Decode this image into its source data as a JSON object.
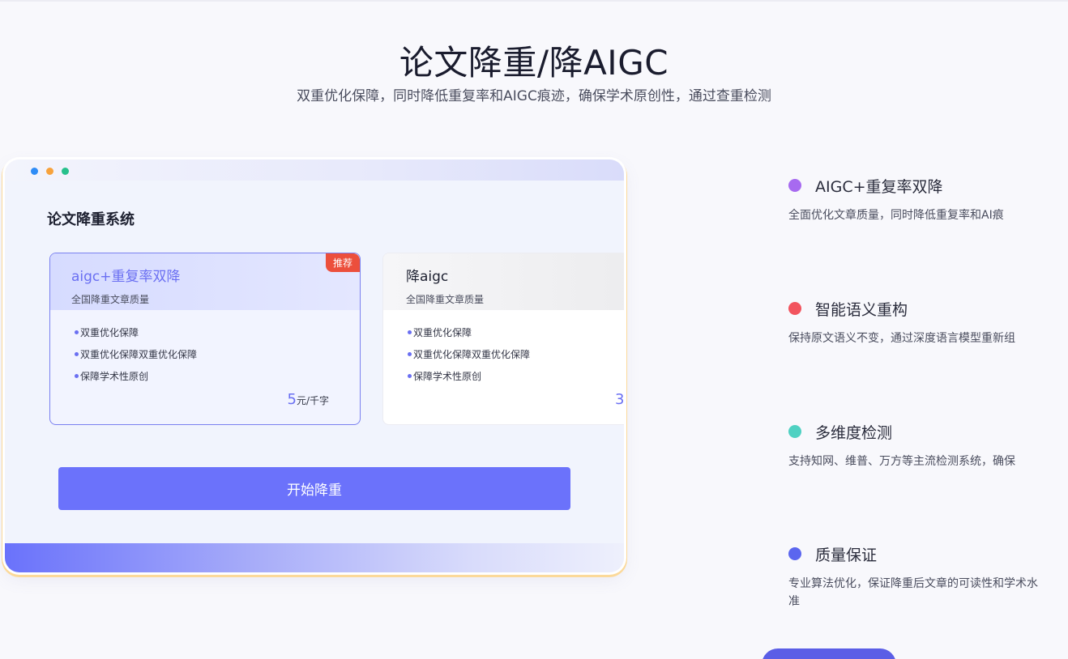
{
  "header": {
    "title": "论文降重/降AIGC",
    "subtitle": "双重优化保障，同时降低重复率和AIGC痕迹，确保学术原创性，通过查重检测"
  },
  "window": {
    "dots": [
      "#2f8cf6",
      "#f7a23c",
      "#27c08c"
    ],
    "system_title": "论文降重系统",
    "plans": [
      {
        "name": "aigc+重复率双降",
        "desc": "全国降重文章质量",
        "badge": "推荐",
        "features": [
          "双重优化保障",
          "双重优化保障双重优化保障",
          "保障学术性原创"
        ],
        "price_value": "5",
        "price_unit": "元/千字"
      },
      {
        "name": "降aigc",
        "desc": "全国降重文章质量",
        "features": [
          "双重优化保障",
          "双重优化保障双重优化保障",
          "保障学术性原创"
        ],
        "price_value": "3"
      }
    ],
    "start_button": "开始降重"
  },
  "features": [
    {
      "title": "AIGC+重复率双降",
      "desc": "全面优化文章质量，同时降低重复率和AI痕",
      "color": "#a76af0"
    },
    {
      "title": "智能语义重构",
      "desc": "保持原文语义不变，通过深度语言模型重新组",
      "color": "#f2545e"
    },
    {
      "title": "多维度检测",
      "desc": "支持知网、维普、万方等主流检测系统，确保",
      "color": "#4fd1c2"
    },
    {
      "title": "质量保证",
      "desc": "专业算法优化，保证降重后文章的可读性和学术水准",
      "color": "#5b66ef"
    }
  ]
}
